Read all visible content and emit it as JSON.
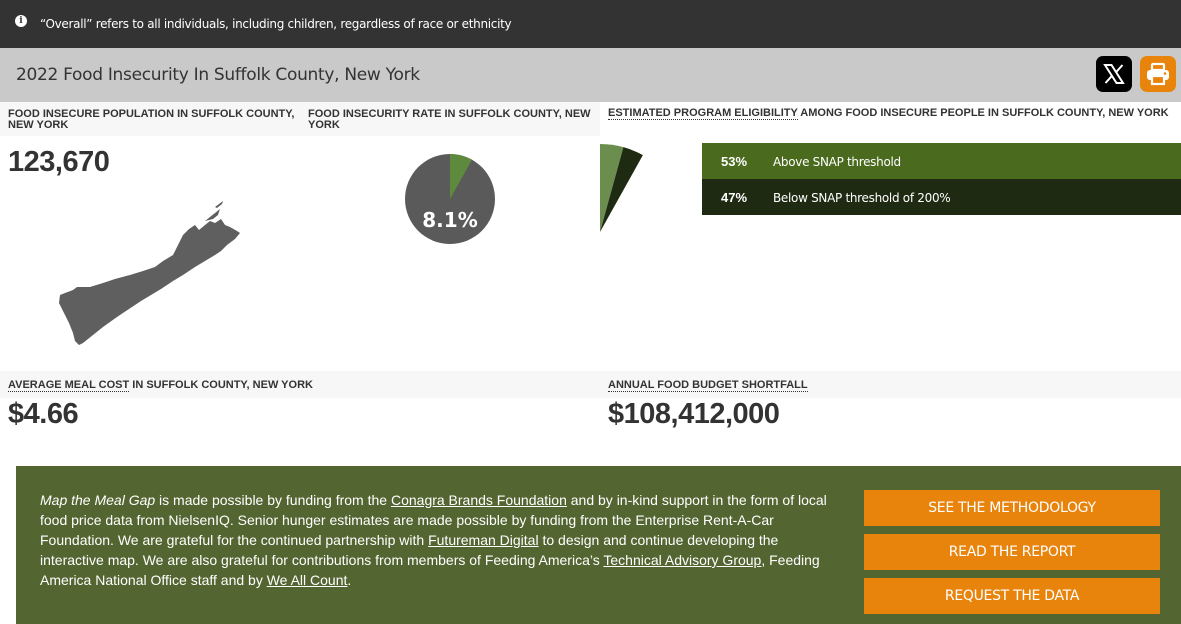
{
  "notice": {
    "icon": "info-icon",
    "text": "“Overall” refers to all individuals, including children, regardless of race or ethnicity"
  },
  "header": {
    "title": "2022 Food Insecurity In Suffolk County, New York",
    "share_icons": [
      "x-twitter-icon",
      "printer-icon"
    ]
  },
  "colors": {
    "green": "#536531",
    "dark_green": "#1e2a12",
    "bright_green": "#4a6a1e",
    "orange": "#e8830c",
    "gray": "#5a5a5a"
  },
  "population": {
    "label": "FOOD INSECURE POPULATION IN SUFFOLK COUNTY, NEW YORK",
    "value": "123,670"
  },
  "rate": {
    "label": "FOOD INSECURITY RATE IN SUFFOLK COUNTY, NEW YORK",
    "value": "8.1%",
    "fraction": 0.081
  },
  "eligibility": {
    "label_link": "ESTIMATED PROGRAM ELIGIBILITY",
    "label_rest": " AMONG FOOD INSECURE PEOPLE IN SUFFOLK COUNTY, NEW YORK",
    "rows": [
      {
        "pct": "53%",
        "text": "Above SNAP threshold",
        "fraction": 0.53
      },
      {
        "pct": "47%",
        "text": "Below SNAP threshold of 200%",
        "fraction": 0.47
      }
    ]
  },
  "meal_cost": {
    "label_link": "AVERAGE MEAL COST",
    "label_rest": " IN SUFFOLK COUNTY, NEW YORK",
    "value": "$4.66"
  },
  "shortfall": {
    "label": "ANNUAL FOOD BUDGET SHORTFALL",
    "value": "$108,412,000"
  },
  "footer": {
    "t1": "Map the Meal Gap",
    "t2": " is made possible by funding from the ",
    "link1": "Conagra Brands Foundation",
    "t3": " and by in-kind support in the form of local food price data from NielsenIQ. Senior hunger estimates are made possible by funding from the Enterprise Rent-A-Car Foundation. We are grateful for the continued partnership with ",
    "link2": "Futureman Digital",
    "t4": " to design and continue developing the interactive map. We are also grateful for contributions from members of Feeding America’s ",
    "link3": "Technical Advisory Group",
    "t5": ", Feeding America National Office staff and by ",
    "link4": "We All Count",
    "t6": ".",
    "buttons": [
      "SEE THE METHODOLOGY",
      "READ THE REPORT",
      "REQUEST THE DATA"
    ]
  }
}
